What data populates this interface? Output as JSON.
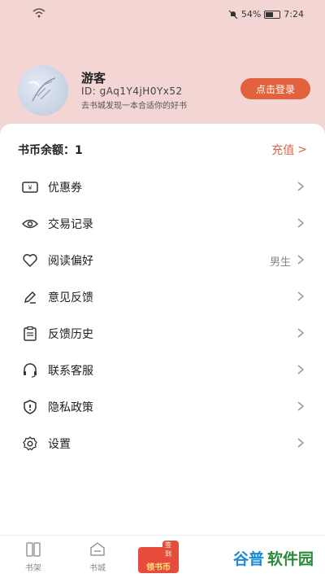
{
  "status_bar": {
    "battery": "54%",
    "time": "7:24"
  },
  "profile": {
    "name": "游客",
    "id_text": "ID: gAq1Y4jH0Yx52",
    "slogan": "去书城发现一本合适你的好书",
    "login_label": "点击登录"
  },
  "balance": {
    "label": "书币余额：",
    "value": "1",
    "recharge_label": "充值",
    "recharge_arrow": ">"
  },
  "menu": {
    "items": [
      {
        "label": "优惠券",
        "icon": "ticket-icon",
        "value": ""
      },
      {
        "label": "交易记录",
        "icon": "eye-icon",
        "value": ""
      },
      {
        "label": "阅读偏好",
        "icon": "heart-icon",
        "value": "男生"
      },
      {
        "label": "意见反馈",
        "icon": "pencil-icon",
        "value": ""
      },
      {
        "label": "反馈历史",
        "icon": "clipboard-icon",
        "value": ""
      },
      {
        "label": "联系客服",
        "icon": "headset-icon",
        "value": ""
      },
      {
        "label": "隐私政策",
        "icon": "shield-icon",
        "value": ""
      },
      {
        "label": "设置",
        "icon": "gear-icon",
        "value": ""
      }
    ]
  },
  "tabbar": {
    "tabs": [
      {
        "label": "书架",
        "icon": "bookshelf-icon"
      },
      {
        "label": "书城",
        "icon": "store-icon"
      }
    ],
    "coin_tab": {
      "badge": "签到",
      "label": "领书币"
    }
  },
  "watermark": {
    "prefix": "谷普",
    "suffix": "软件园"
  },
  "colors": {
    "header_bg": "#f3d6d3",
    "accent": "#e2623e",
    "recharge": "#d9644a"
  }
}
